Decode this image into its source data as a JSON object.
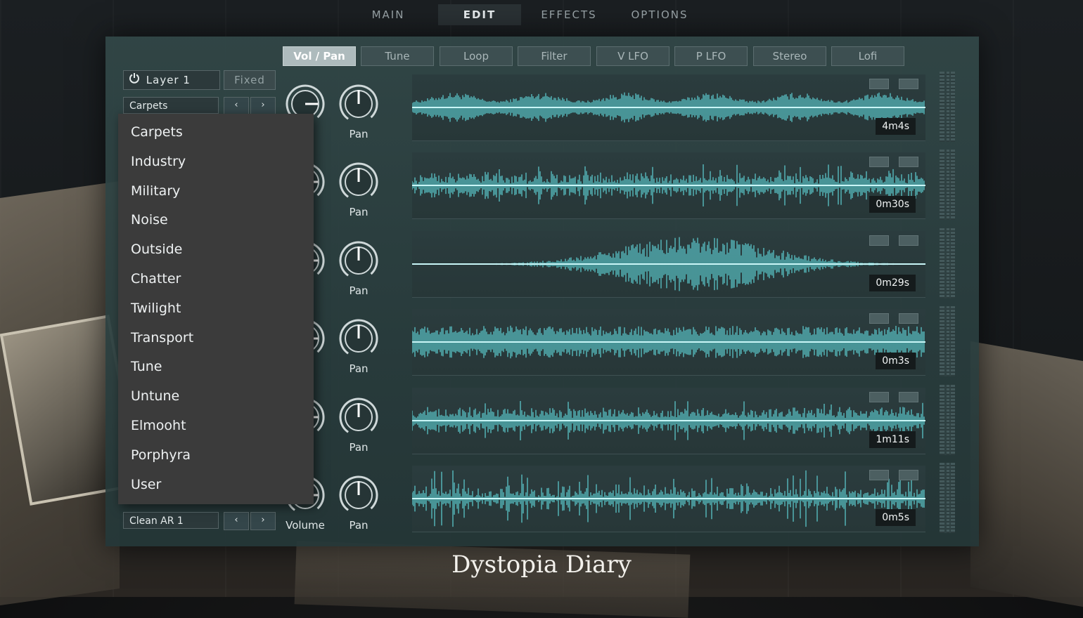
{
  "nav": {
    "tabs": [
      {
        "label": "MAIN",
        "active": false
      },
      {
        "label": "EDIT",
        "active": true
      },
      {
        "label": "EFFECTS",
        "active": false
      },
      {
        "label": "OPTIONS",
        "active": false
      }
    ]
  },
  "subtabs": [
    {
      "label": "Vol / Pan",
      "active": true
    },
    {
      "label": "Tune",
      "active": false
    },
    {
      "label": "Loop",
      "active": false
    },
    {
      "label": "Filter",
      "active": false
    },
    {
      "label": "V LFO",
      "active": false
    },
    {
      "label": "P LFO",
      "active": false
    },
    {
      "label": "Stereo",
      "active": false
    },
    {
      "label": "Lofi",
      "active": false
    }
  ],
  "layer": {
    "name": "Layer 1",
    "mode_label": "Fixed",
    "category_select": "Carpets",
    "preset_select": "Clean AR 1",
    "prev_glyph": "‹",
    "next_glyph": "›"
  },
  "dropdown": {
    "items": [
      "Carpets",
      "Industry",
      "Military",
      "Noise",
      "Outside",
      "Chatter",
      "Twilight",
      "Transport",
      "Tune",
      "Untune",
      "Elmooht",
      "Porphyra",
      "User"
    ]
  },
  "knob_labels": {
    "volume": "Volume",
    "volume_partial": "ne",
    "pan": "Pan"
  },
  "tracks": [
    {
      "duration": "4m4s"
    },
    {
      "duration": "0m30s"
    },
    {
      "duration": "0m29s"
    },
    {
      "duration": "0m3s"
    },
    {
      "duration": "1m11s"
    },
    {
      "duration": "0m5s"
    }
  ],
  "colors": {
    "waveform": "#5fd2d6",
    "waveform_core": "#c9f6f7"
  },
  "brand": "Dystopia Diary"
}
